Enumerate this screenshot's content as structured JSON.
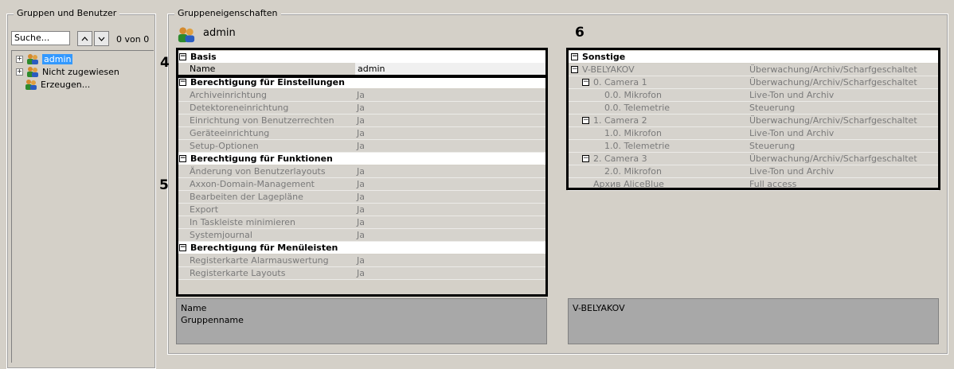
{
  "left_panel": {
    "title": "Gruppen und Benutzer",
    "search_value": "Suche...",
    "counter": "0 von 0",
    "tree": [
      "admin",
      "Nicht zugewiesen",
      "Erzeugen..."
    ]
  },
  "right_panel": {
    "title": "Gruppeneigenschaften",
    "group_name": "admin"
  },
  "markers": {
    "m4": "4",
    "m5": "5",
    "m6": "6"
  },
  "grid1": {
    "cat_basis": "Basis",
    "name_label": "Name",
    "name_value": "admin",
    "cat_settings": "Berechtigung für Einstellungen",
    "settings": [
      {
        "name": "Archiveinrichtung",
        "value": "Ja"
      },
      {
        "name": "Detektoreneinrichtung",
        "value": "Ja"
      },
      {
        "name": "Einrichtung von Benutzerrechten",
        "value": "Ja"
      },
      {
        "name": "Geräteeinrichtung",
        "value": "Ja"
      },
      {
        "name": "Setup-Optionen",
        "value": "Ja"
      }
    ],
    "cat_functions": "Berechtigung für Funktionen",
    "functions": [
      {
        "name": "Änderung von Benutzerlayouts",
        "value": "Ja"
      },
      {
        "name": "Axxon-Domain-Management",
        "value": "Ja"
      },
      {
        "name": "Bearbeiten der Lagepläne",
        "value": "Ja"
      },
      {
        "name": "Export",
        "value": "Ja"
      },
      {
        "name": "In Taskleiste minimieren",
        "value": "Ja"
      },
      {
        "name": "Systemjournal",
        "value": "Ja"
      }
    ],
    "cat_menus": "Berechtigung für Menüleisten",
    "menus": [
      {
        "name": "Registerkarte Alarmauswertung",
        "value": "Ja"
      },
      {
        "name": "Registerkarte Layouts",
        "value": "Ja"
      }
    ],
    "desc_title": "Name",
    "desc_text": "Gruppenname"
  },
  "grid2": {
    "cat_other": "Sonstige",
    "rows": [
      {
        "name": "V-BELYAKOV",
        "value": "Überwachung/Archiv/Scharfgeschaltet"
      },
      {
        "name": "0. Camera 1",
        "value": "Überwachung/Archiv/Scharfgeschaltet"
      },
      {
        "name": "0.0. Mikrofon",
        "value": "Live-Ton und Archiv"
      },
      {
        "name": "0.0. Telemetrie",
        "value": "Steuerung"
      },
      {
        "name": "1. Camera 2",
        "value": "Überwachung/Archiv/Scharfgeschaltet"
      },
      {
        "name": "1.0. Mikrofon",
        "value": "Live-Ton und Archiv"
      },
      {
        "name": "1.0. Telemetrie",
        "value": "Steuerung"
      },
      {
        "name": "2. Camera 3",
        "value": "Überwachung/Archiv/Scharfgeschaltet"
      },
      {
        "name": "2.0. Mikrofon",
        "value": "Live-Ton und Archiv"
      },
      {
        "name": "Архив AliceBlue",
        "value": "Full access"
      }
    ],
    "desc_title": "V-BELYAKOV"
  }
}
